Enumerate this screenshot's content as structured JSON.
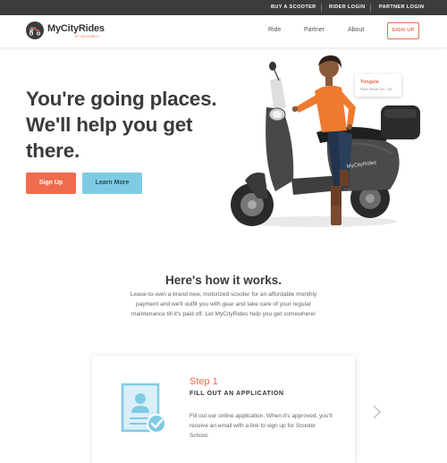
{
  "topbar": {
    "links": [
      "BUY A SCOOTER",
      "RIDER LOGIN",
      "PARTNER LOGIN"
    ]
  },
  "nav": {
    "brand_name": "MyCityRides",
    "brand_sub": "BY ASSEMBLY",
    "links": [
      "Ride",
      "Partner",
      "About"
    ],
    "signup_label": "SIGN UP"
  },
  "hero": {
    "headline_lines": [
      "You're going places.",
      "We'll help you get",
      "there."
    ],
    "primary_button": "Sign Up",
    "secondary_button": "Learn More",
    "rider_tag": {
      "name": "Tongela",
      "since": "Flyer Since Oct. '18"
    },
    "scooter_decal": "MyCityRides"
  },
  "how": {
    "title": "Here's how it works.",
    "body": "Lease-to-own a brand new, motorized scooter for an affordable monthly payment and we'll outfit you with gear and take care of your regular maintenance till it's paid off. Let MyCityRides help you get somewhere!"
  },
  "step": {
    "number": "Step 1",
    "title": "FILL OUT AN APPLICATION",
    "body": "Fill out our online application. When it's approved, you'll receive an email with a link to sign up for Scooter School."
  },
  "colors": {
    "accent": "#ef6b4e",
    "secondary": "#7fcbe4",
    "topbar": "#3c3c3c"
  },
  "icons": [
    "scooter-logo-icon",
    "document-check-icon",
    "chevron-right-icon"
  ]
}
